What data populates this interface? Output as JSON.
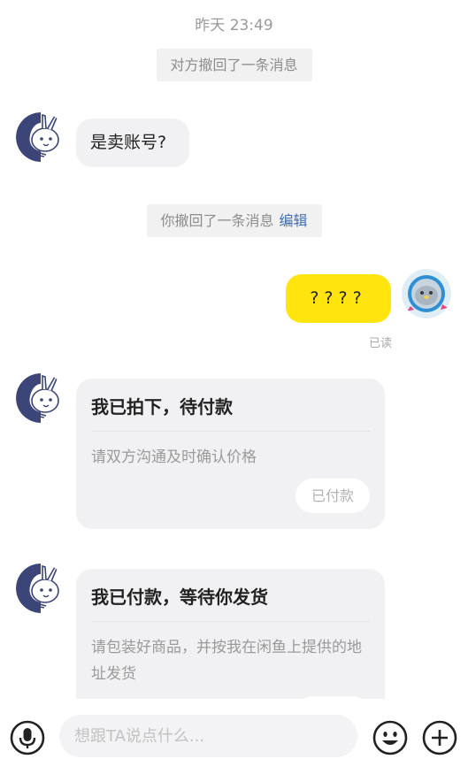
{
  "chat": {
    "timestamp": "昨天 23:49",
    "notice_retracted_other": "对方撤回了一条消息",
    "msg_other_1": "是卖账号?",
    "notice_retracted_self": "你撤回了一条消息",
    "notice_edit_label": "编辑",
    "msg_self_1": "????",
    "read_status": "已读",
    "card_1": {
      "title": "我已拍下，待付款",
      "desc": "请双方沟通及时确认价格",
      "button": "已付款"
    },
    "card_2": {
      "title": "我已付款，等待你发货",
      "desc": "请包装好商品，并按我在闲鱼上提供的地址发货"
    }
  },
  "inputbar": {
    "placeholder": "想跟TA说点什么..."
  },
  "icons": {
    "voice": "microphone-icon",
    "emoji": "emoji-icon",
    "more": "plus-icon"
  },
  "colors": {
    "self_bubble": "#ffe40d",
    "bubble_gray": "#f1f1f3",
    "link": "#3e6eb3"
  }
}
